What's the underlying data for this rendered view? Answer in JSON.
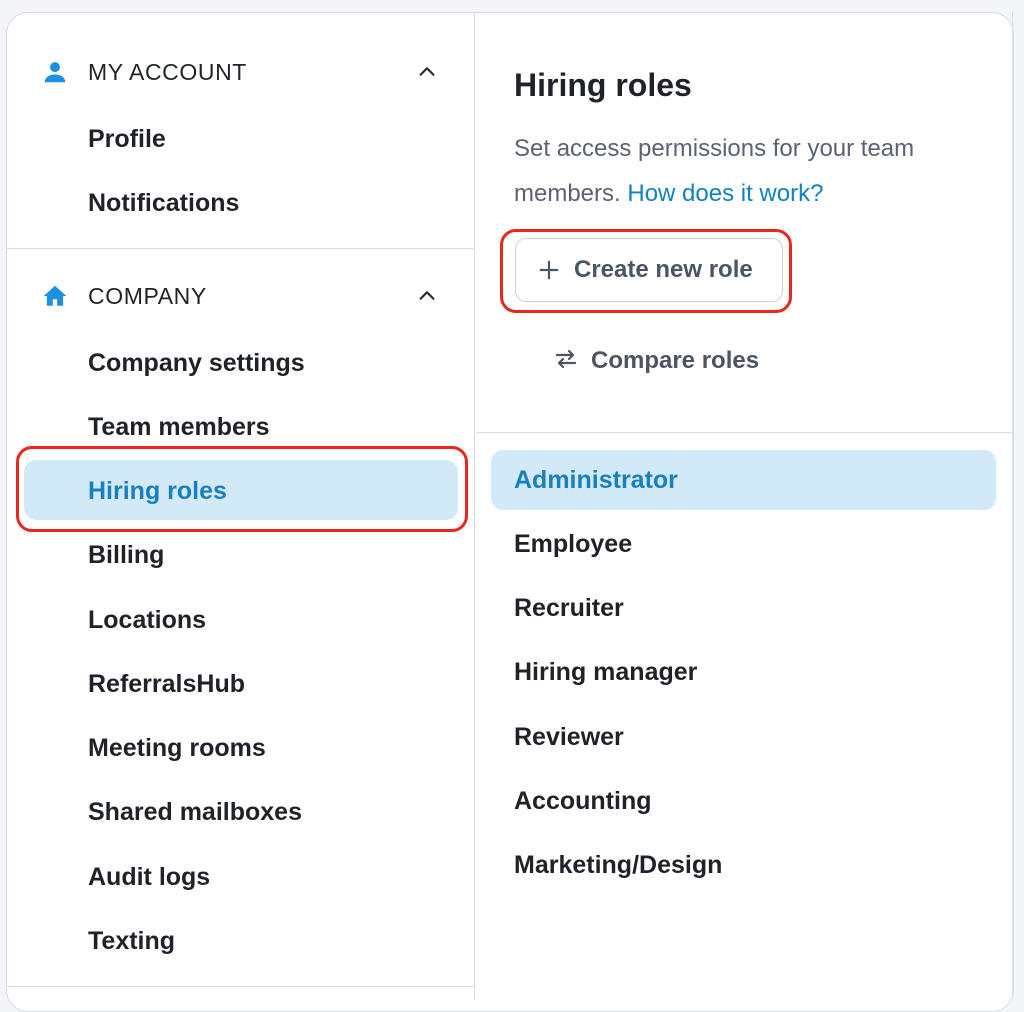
{
  "sidebar": {
    "my_account": {
      "title": "MY ACCOUNT",
      "icon": "person-icon",
      "items": [
        "Profile",
        "Notifications"
      ]
    },
    "company": {
      "title": "COMPANY",
      "icon": "home-icon",
      "items": [
        "Company settings",
        "Team members",
        "Hiring roles",
        "Billing",
        "Locations",
        "ReferralsHub",
        "Meeting rooms",
        "Shared mailboxes",
        "Audit logs",
        "Texting"
      ],
      "active_item": "Hiring roles"
    }
  },
  "panel": {
    "title": "Hiring roles",
    "description": "Set access permissions for your team members.",
    "help_link": "How does it work?",
    "create_button": "Create new role",
    "compare_button": "Compare roles",
    "roles": [
      "Administrator",
      "Employee",
      "Recruiter",
      "Hiring manager",
      "Reviewer",
      "Accounting",
      "Marketing/Design"
    ],
    "active_role": "Administrator"
  },
  "colors": {
    "accent": "#1a7fbd",
    "active_bg": "#d2eaf8",
    "highlight_ring": "#e8281c",
    "icon_blue": "#1e90e0"
  }
}
